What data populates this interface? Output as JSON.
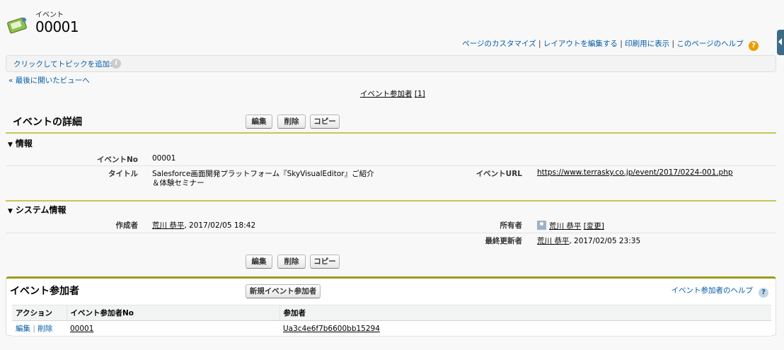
{
  "header": {
    "object_type": "イベント",
    "record_name": "00001",
    "links": [
      "ページのカスタマイズ",
      "レイアウトを編集する",
      "印刷用に表示",
      "このページのヘルプ"
    ],
    "help_glyph": "?"
  },
  "topic_bar": {
    "label": "クリックしてトピックを追加:",
    "info_glyph": "i"
  },
  "back_link": "« 最後に開いたビューへ",
  "related_jump": {
    "label": "イベント参加者",
    "count": "[1]"
  },
  "detail": {
    "title": "イベントの詳細",
    "buttons": {
      "edit": "編集",
      "delete": "削除",
      "copy": "コピー"
    },
    "info_section": {
      "heading": "情報",
      "fields": {
        "event_no_label": "イベントNo",
        "event_no_value": "00001",
        "title_label": "タイトル",
        "title_value_line1": "Salesforce画面開発プラットフォーム『SkyVisualEditor』ご紹介",
        "title_value_line2": "＆体験セミナー",
        "url_label": "イベントURL",
        "url_value": "https://www.terrasky.co.jp/event/2017/0224-001.php"
      }
    },
    "system_section": {
      "heading": "システム情報",
      "fields": {
        "created_by_label": "作成者",
        "created_by_user": "荒川 恭平",
        "created_by_date": ", 2017/02/05 18:42",
        "owner_label": "所有者",
        "owner_user": "荒川 恭平",
        "owner_change": "[変更]",
        "modified_by_label": "最終更新者",
        "modified_by_user": "荒川 恭平",
        "modified_by_date": ", 2017/02/05 23:35"
      }
    }
  },
  "related_list": {
    "title": "イベント参加者",
    "new_button": "新規イベント参加者",
    "help_link": "イベント参加者のヘルプ",
    "help_glyph": "?",
    "columns": [
      "アクション",
      "イベント参加者No",
      "参加者"
    ],
    "rows": [
      {
        "action_edit": "編集",
        "action_delete": "削除",
        "no": "00001",
        "participant": "Ua3c4e6f7b6600bb15294"
      }
    ]
  },
  "colors": {
    "link": "#015ba7",
    "section_rule": "#c5c55a",
    "related_border": "#9c9c1a",
    "help_orange": "#e8a000"
  }
}
